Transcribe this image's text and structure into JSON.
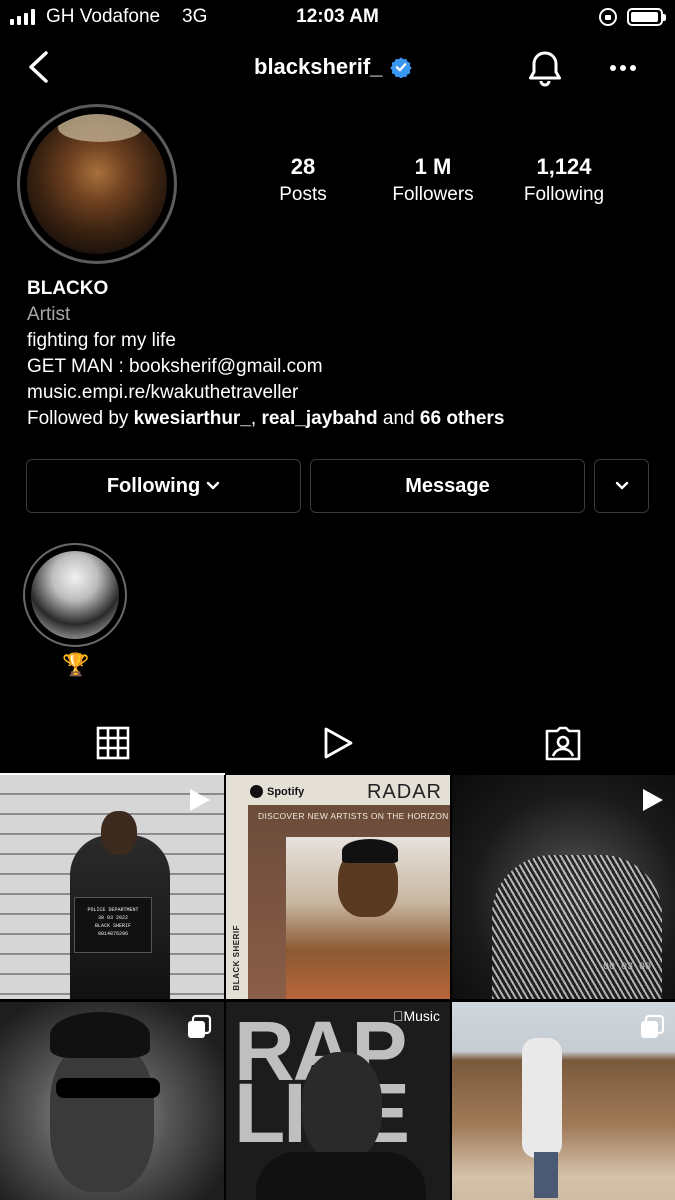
{
  "status_bar": {
    "carrier": "GH Vodafone",
    "network": "3G",
    "time": "12:03 AM",
    "battery_level": 0.95
  },
  "header": {
    "username": "blacksherif_",
    "verified": true,
    "icons": [
      "back-icon",
      "verified-icon",
      "bell-icon",
      "more-icon"
    ],
    "accent": "#3897f0"
  },
  "stats": {
    "posts": {
      "value": "28",
      "label": "Posts"
    },
    "followers": {
      "value": "1 M",
      "label": "Followers"
    },
    "following": {
      "value": "1,124",
      "label": "Following"
    }
  },
  "bio": {
    "name": "BLACKO",
    "category": "Artist",
    "line1": "fighting for my life",
    "line2": "GET MAN : booksherif@gmail.com",
    "link": "music.empi.re/kwakuthetraveller",
    "followed_by_prefix": "Followed by ",
    "followed_by_user1": "kwesiarthur_",
    "followed_by_sep": ", ",
    "followed_by_user2": "real_jaybahd",
    "followed_by_and": " and ",
    "followed_by_others": "66 others"
  },
  "buttons": {
    "following": "Following",
    "message": "Message"
  },
  "highlight": {
    "emoji": "🏆"
  },
  "tabs": [
    "grid-icon",
    "reels-icon",
    "tagged-icon"
  ],
  "posts": [
    {
      "type": "reel",
      "sign_line1": "POLICE DEPARTMENT",
      "sign_line2": "30 03 2022",
      "sign_line3": "BLACK SHERIF",
      "sign_line4": "0014876296"
    },
    {
      "type": "image",
      "brand": "Spotify",
      "title": "RADAR",
      "tagline": "DISCOVER NEW ARTISTS ON THE HORIZON",
      "side_text": "BLACK SHERIF"
    },
    {
      "type": "reel",
      "timestamp": "00 03 00"
    },
    {
      "type": "carousel"
    },
    {
      "type": "carousel",
      "brand": "Music",
      "title_l1": "RAP",
      "title_l2": "LIFE"
    },
    {
      "type": "carousel"
    }
  ]
}
